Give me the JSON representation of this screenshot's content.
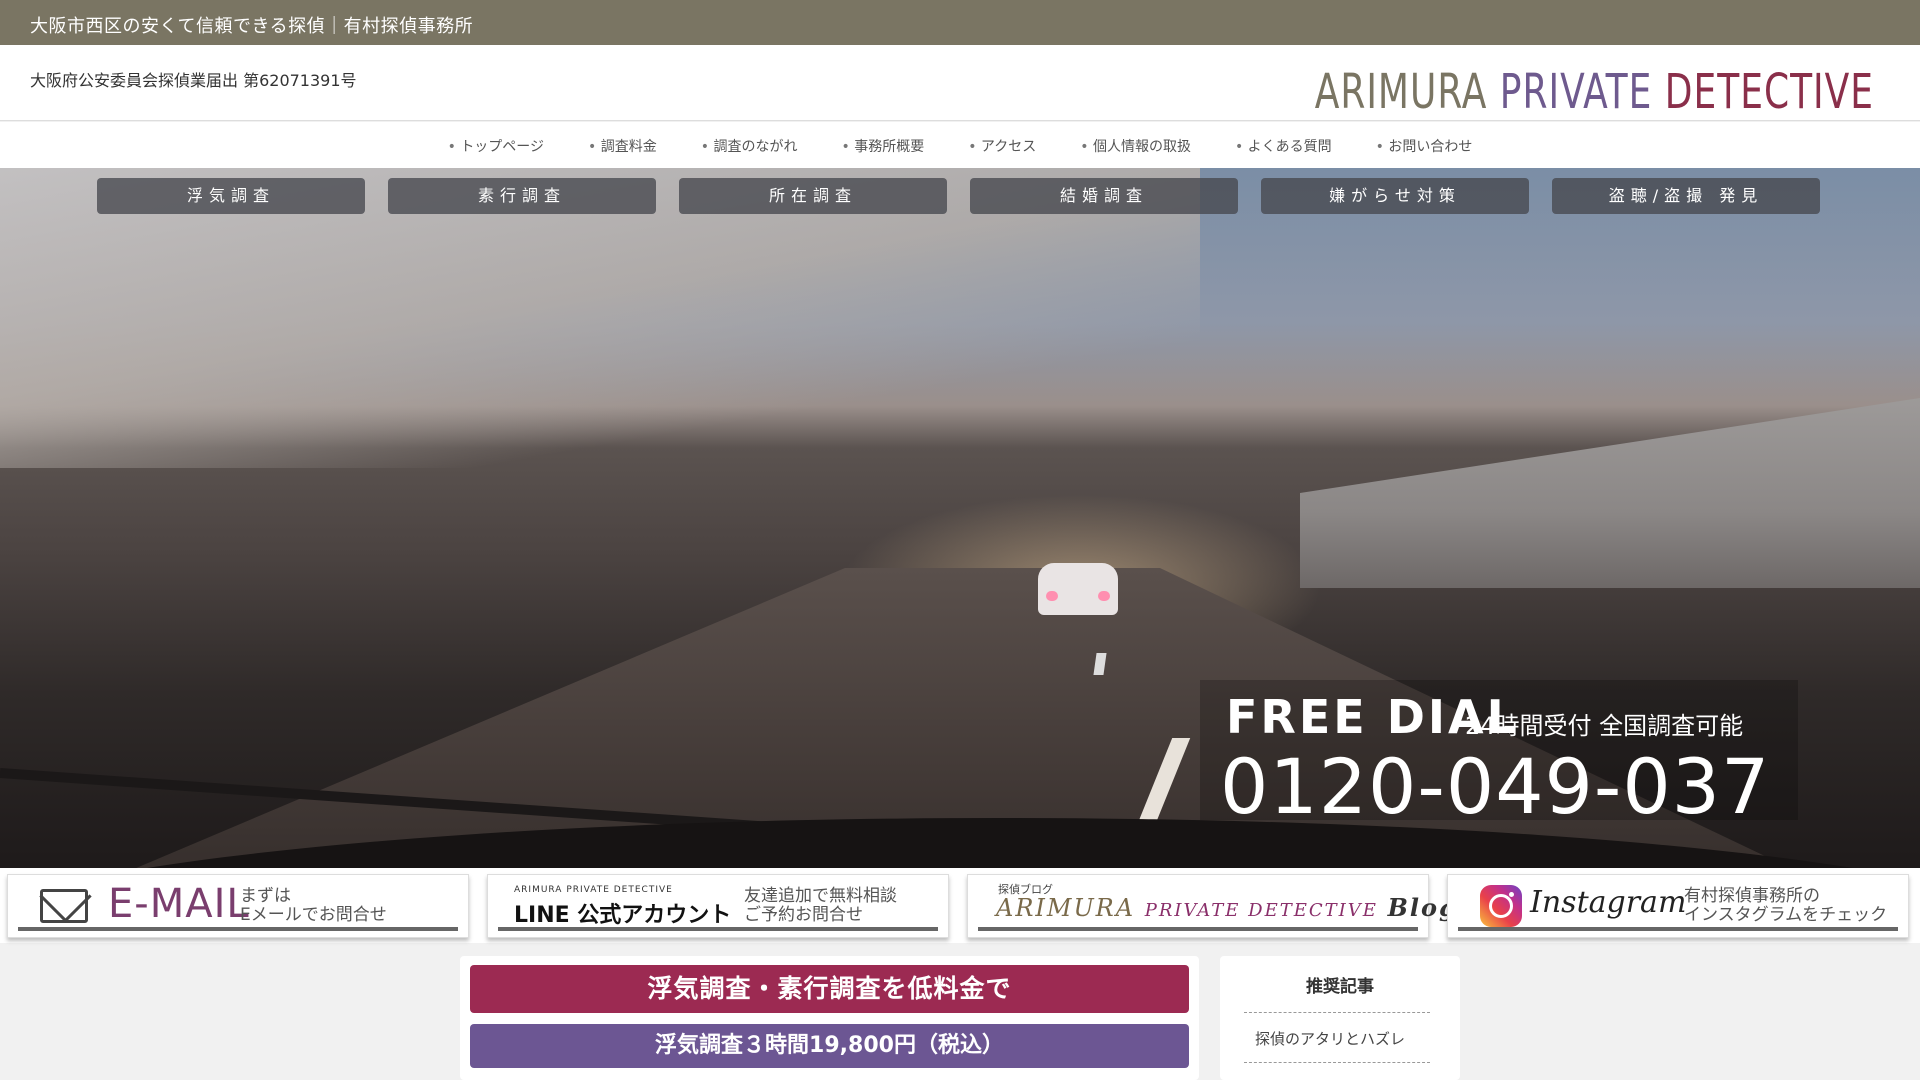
{
  "site_title": "大阪市西区の安くて信頼できる探偵｜有村探偵事務所",
  "header": {
    "license": "大阪府公安委員会探偵業届出 第62071391号",
    "logo": {
      "word1": "ARIMURA",
      "word2": "PRIVATE",
      "word3": "DETECTIVE"
    }
  },
  "nav": {
    "items": [
      "トップページ",
      "調査料金",
      "調査のながれ",
      "事務所概要",
      "アクセス",
      "個人情報の取扱",
      "よくある質問",
      "お問い合わせ"
    ]
  },
  "categories": [
    "浮気調査",
    "素行調査",
    "所在調査",
    "結婚調査",
    "嫌がらせ対策",
    "盗聴/盗撮 発見"
  ],
  "hero": {
    "free_dial_label": "FREE DIAL",
    "free_dial_sub": "24時間受付 全国調査可能",
    "phone": "0120-049-037"
  },
  "banners": {
    "email": {
      "icon": "envelope-icon",
      "title": "E-MAIL",
      "desc1": "まずは",
      "desc2": "Eメールでお問合せ"
    },
    "line": {
      "small": "ARIMURA PRIVATE DETECTIVE",
      "title": "LINE 公式アカウント",
      "desc1": "友達追加で無料相談",
      "desc2": "ご予約お問合せ"
    },
    "blog": {
      "small": "探偵ブログ",
      "title1": "ARIMURA",
      "title2": "PRIVATE DETECTIVE",
      "title3": "Blog"
    },
    "instagram": {
      "icon": "instagram-icon",
      "title": "Instagram",
      "desc1": "有村探偵事務所の",
      "desc2": "インスタグラムをチェック"
    }
  },
  "main": {
    "promo1": "浮気調査・素行調査を低料金で",
    "promo2": "浮気調査３時間19,800円（税込）"
  },
  "sidebar": {
    "title": "推奨記事",
    "items": [
      "探偵のアタリとハズレ"
    ]
  },
  "colors": {
    "title_bar": "#7a7563",
    "promo_red": "#9c2a52",
    "promo_purple": "#6c5693"
  }
}
